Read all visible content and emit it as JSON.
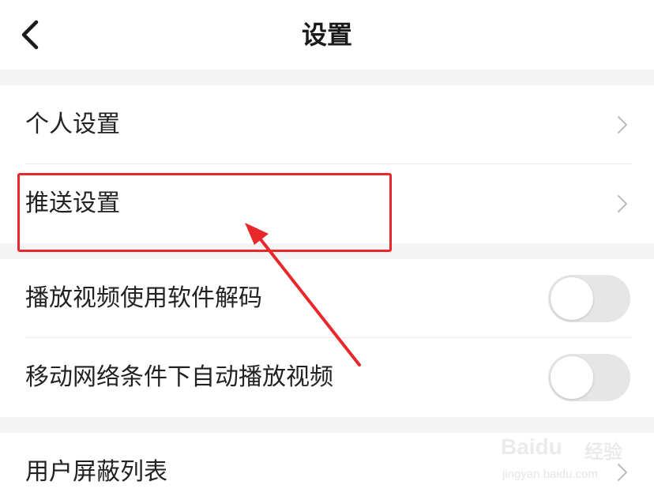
{
  "header": {
    "title": "设置",
    "back_icon": "chevron-left-icon"
  },
  "group1": {
    "items": [
      {
        "label": "个人设置",
        "icon": "chevron-right-icon"
      },
      {
        "label": "推送设置",
        "icon": "chevron-right-icon"
      }
    ]
  },
  "group2": {
    "items": [
      {
        "label": "播放视频使用软件解码",
        "toggle_on": false
      },
      {
        "label": "移动网络条件下自动播放视频",
        "toggle_on": false
      }
    ]
  },
  "group3": {
    "items": [
      {
        "label": "用户屏蔽列表",
        "icon": "chevron-right-icon"
      }
    ]
  },
  "annotation": {
    "color": "#e8282b",
    "highlighted_item": "推送设置"
  },
  "watermark": {
    "brand": "Baidu",
    "brand_cn": "经验",
    "url": "jingyan.baidu.com"
  }
}
